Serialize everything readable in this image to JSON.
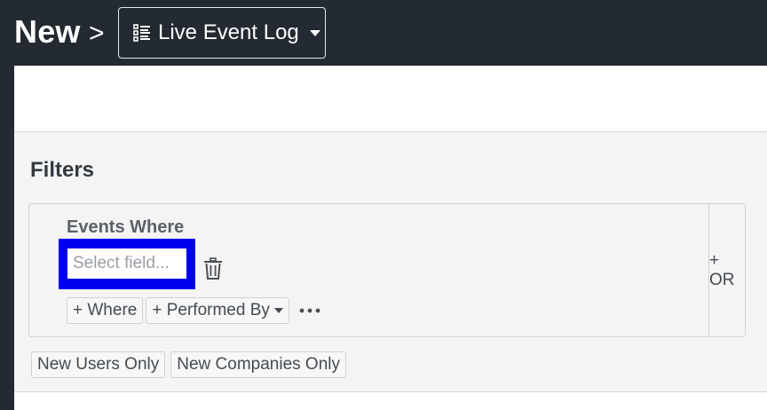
{
  "header": {
    "title": "New",
    "separator": ">",
    "view_select": {
      "label": "Live Event Log",
      "icon": "list-icon"
    }
  },
  "filters": {
    "title": "Filters",
    "group": {
      "heading": "Events Where",
      "field_placeholder": "Select field...",
      "field_value": "",
      "add_where_label": "+ Where",
      "add_performed_by_label": "+ Performed By",
      "or_label": "+ OR"
    },
    "quick_filters": [
      "New Users Only",
      "New Companies Only"
    ]
  },
  "colors": {
    "topbar_bg": "#232a31",
    "highlight": "#0000ee",
    "filters_bg": "#f4f4f4"
  }
}
